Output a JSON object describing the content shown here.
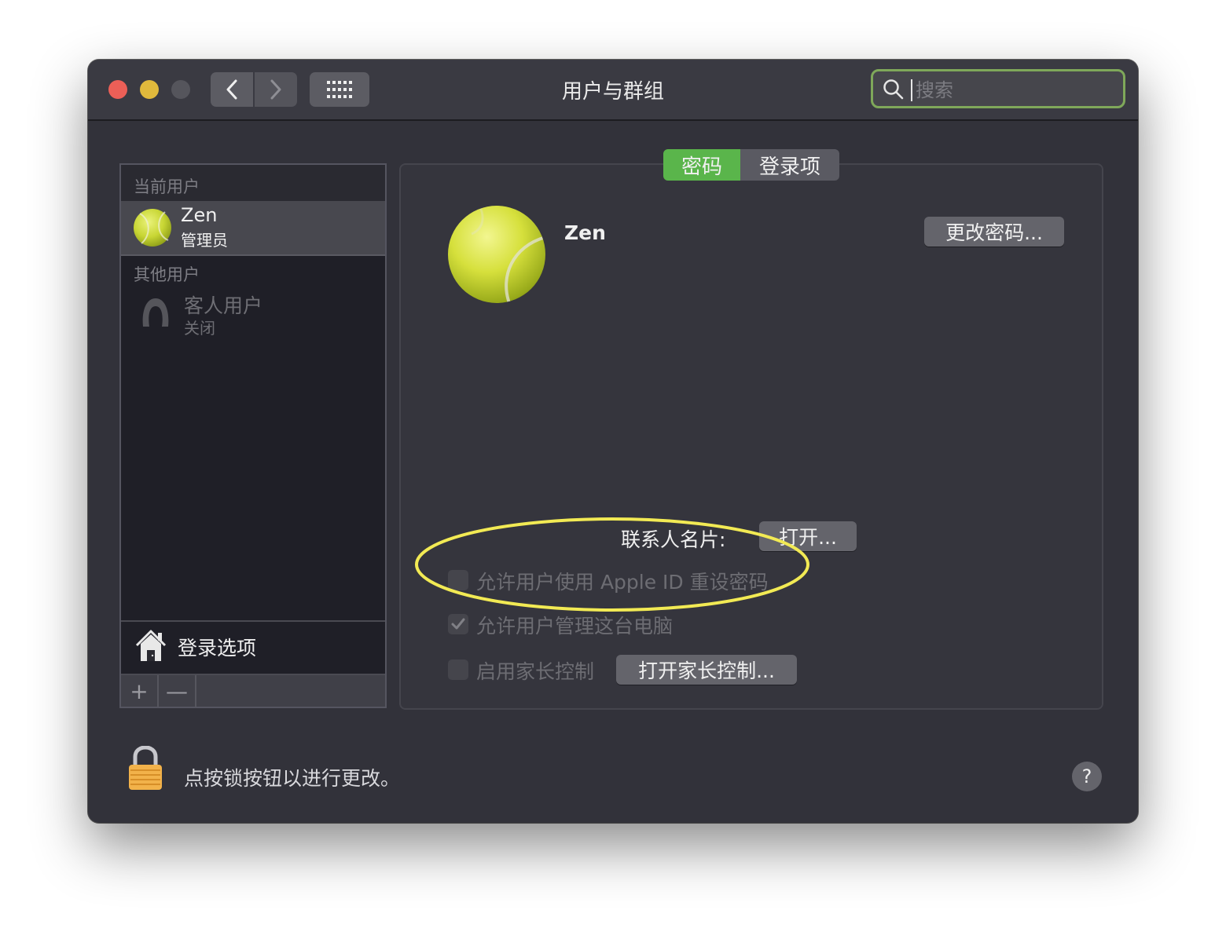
{
  "window": {
    "title": "用户与群组"
  },
  "search": {
    "placeholder": "搜索"
  },
  "sidebar": {
    "current_section": "当前用户",
    "current_user": {
      "name": "Zen",
      "role": "管理员"
    },
    "other_section": "其他用户",
    "guest_user": {
      "name": "客人用户",
      "status": "关闭"
    },
    "login_options": "登录选项",
    "add_symbol": "+",
    "remove_symbol": "—"
  },
  "tabs": [
    {
      "label": "密码",
      "active": true
    },
    {
      "label": "登录项",
      "active": false
    }
  ],
  "main": {
    "user_name": "Zen",
    "change_password": "更改密码...",
    "contact_card_label": "联系人名片:",
    "open_button": "打开...",
    "options": [
      {
        "label": "允许用户使用 Apple ID 重设密码",
        "checked": false
      },
      {
        "label": "允许用户管理这台电脑",
        "checked": true
      },
      {
        "label": "启用家长控制",
        "checked": false
      }
    ],
    "parental_controls_button": "打开家长控制..."
  },
  "footer": {
    "lock_text": "点按锁按钮以进行更改。",
    "help_symbol": "?"
  },
  "colors": {
    "accent_tab": "#5ab54b",
    "search_focus": "#7fa85a",
    "annotation": "#f2ea54"
  }
}
